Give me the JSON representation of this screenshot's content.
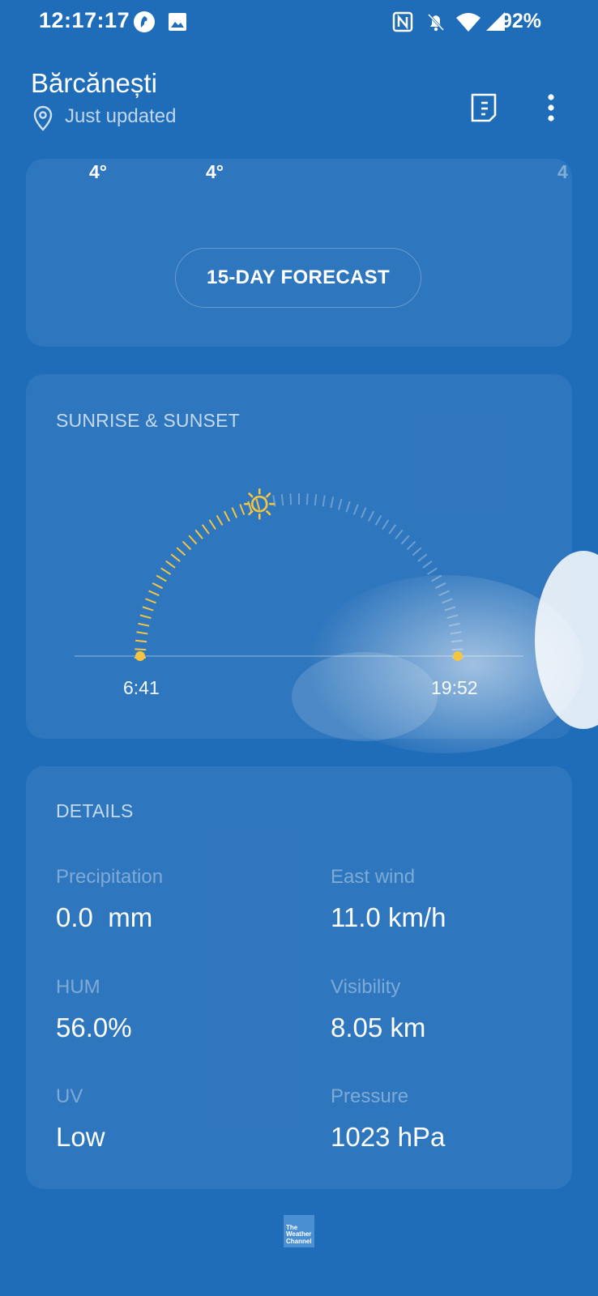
{
  "status_bar": {
    "time": "12:17:17",
    "battery": "92%",
    "icons": [
      "app-notification-icon",
      "image-icon",
      "nfc-icon",
      "bell-off-icon",
      "wifi-icon",
      "signal-icon"
    ]
  },
  "header": {
    "city": "Bărcănești",
    "status": "Just updated",
    "icons": [
      "location-pin-icon",
      "document-icon",
      "more-vert-icon"
    ]
  },
  "hourly": {
    "temps": [
      "4°",
      "4°",
      "4"
    ]
  },
  "forecast_button": {
    "label": "15-DAY FORECAST"
  },
  "sun": {
    "title": "SUNRISE & SUNSET",
    "sunrise": "6:41",
    "sunset": "19:52",
    "arc_color": "#f4c542",
    "day_progress": 0.42
  },
  "details": {
    "title": "DETAILS",
    "items": [
      {
        "label": "Precipitation",
        "value": "0.0  mm"
      },
      {
        "label": "East wind",
        "value": "11.0 km/h"
      },
      {
        "label": "HUM",
        "value": "56.0%"
      },
      {
        "label": "Visibility",
        "value": "8.05 km"
      },
      {
        "label": "UV",
        "value": "Low"
      },
      {
        "label": "Pressure",
        "value": "1023 hPa"
      }
    ]
  },
  "footer": {
    "logo_text": "The Weather Channel"
  },
  "colors": {
    "background": "#1f6cb9",
    "accent_sun": "#f4c542"
  }
}
